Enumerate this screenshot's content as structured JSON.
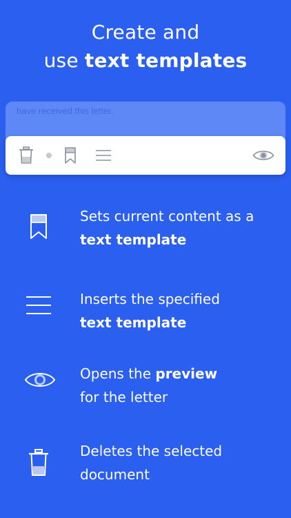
{
  "headline": {
    "line1": "Create and",
    "line2_plain": "use ",
    "line2_bold": "text templates"
  },
  "editor": {
    "text_snippet": "have received this letter."
  },
  "toolbar": {
    "icons": [
      "trash-icon",
      "dot-separator",
      "bookmark-icon",
      "menu-lines-icon",
      "eye-icon"
    ],
    "icon_color": "#8c909b"
  },
  "features": [
    {
      "icon": "bookmark-icon",
      "text": "Sets current content as a",
      "bold": "text template"
    },
    {
      "icon": "menu-lines-icon",
      "text": "Inserts the specified",
      "bold": "text template"
    },
    {
      "icon": "eye-icon",
      "text_before": "Opens the ",
      "bold": "preview",
      "text_after": "for the letter"
    },
    {
      "icon": "trash-icon",
      "text": "Deletes the selected",
      "text2": "document"
    }
  ],
  "colors": {
    "background": "#2a5ff0",
    "editor_strip": "#5d88f5",
    "toolbar_bg": "#ffffff",
    "text": "#ffffff"
  }
}
